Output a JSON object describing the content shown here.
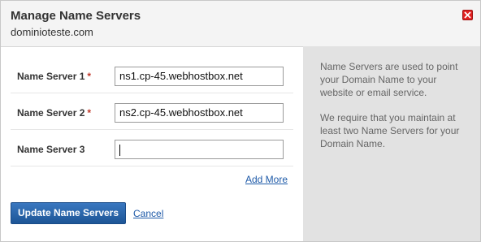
{
  "header": {
    "title": "Manage Name Servers",
    "domain": "dominioteste.com"
  },
  "form": {
    "rows": [
      {
        "label": "Name Server 1",
        "required": "*",
        "value": "ns1.cp-45.webhostbox.net"
      },
      {
        "label": "Name Server 2",
        "required": "*",
        "value": "ns2.cp-45.webhostbox.net"
      },
      {
        "label": "Name Server 3",
        "required": "",
        "value": ""
      }
    ],
    "add_more": "Add More",
    "submit": "Update Name Servers",
    "cancel": "Cancel"
  },
  "sidebar": {
    "p1": "Name Servers are used to point your Domain Name to your website or email service.",
    "p2": "We require that you maintain at least two Name Servers for your Domain Name."
  },
  "colors": {
    "primary_button": "#2a65ad",
    "link": "#1e5aa8",
    "required": "#c0392b",
    "sidebar_bg": "#e2e2e2"
  },
  "icons": {
    "close": "close-icon"
  }
}
